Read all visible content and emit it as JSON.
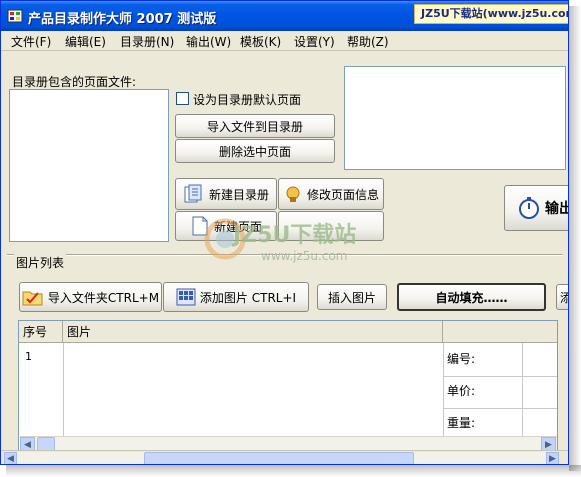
{
  "window": {
    "title": "产品目录制作大师 2007 测试版"
  },
  "watermark": {
    "top_badge": "JZ5U下载站(www.jz5u.com)",
    "logo_text": "JZ5U下载站",
    "logo_url": "www.jz5u.com"
  },
  "menu": [
    "文件(F)",
    "编辑(E)",
    "目录册(N)",
    "输出(W)",
    "模板(K)",
    "设置(Y)",
    "帮助(Z)"
  ],
  "catalog": {
    "pages_label": "目录册包含的页面文件:",
    "default_page_label": "设为目录册默认页面",
    "default_page_checked": false,
    "import_btn": "导入文件到目录册",
    "delete_btn": "删除选中页面",
    "new_catalog_btn": "新建目录册",
    "edit_page_btn": "修改页面信息",
    "new_page_btn": "新建页面",
    "output_btn": "输出"
  },
  "images": {
    "section_label": "图片列表",
    "import_folder_btn": "导入文件夹CTRL+M",
    "add_image_btn": "添加图片 CTRL+I",
    "insert_image_btn": "插入图片",
    "autofill_btn": "自动填充……",
    "more_btn": "添",
    "columns": [
      "序号",
      "图片"
    ],
    "rows": [
      {
        "index": "1"
      }
    ],
    "fields": [
      "编号:",
      "单价:",
      "重量:"
    ]
  },
  "colors": {
    "titlebar": "#0054e3",
    "face": "#ece9d8",
    "border": "#7f9db9"
  }
}
